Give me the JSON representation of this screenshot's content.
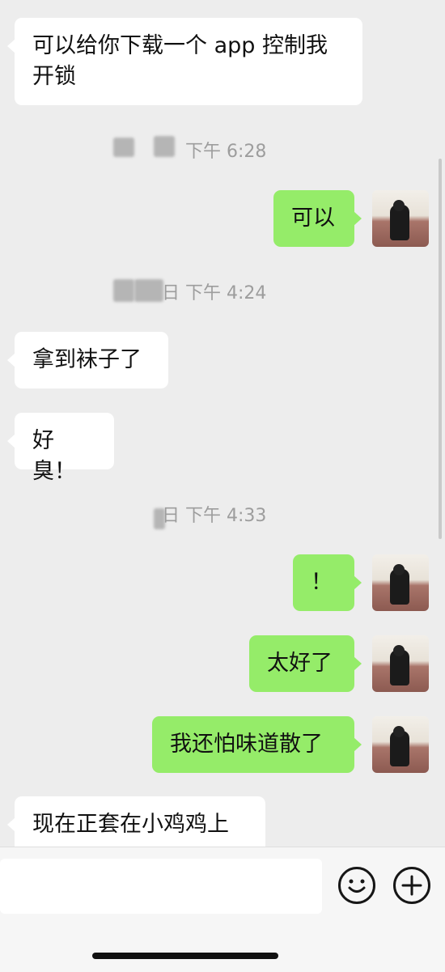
{
  "messages": [
    {
      "side": "left",
      "text": "可以给你下载一个 app 控制我开锁"
    },
    {
      "side": "right",
      "text": "可以"
    },
    {
      "side": "left",
      "text": "拿到袜子了"
    },
    {
      "side": "left",
      "text": "好臭！"
    },
    {
      "side": "right",
      "text": "！"
    },
    {
      "side": "right",
      "text": "太好了"
    },
    {
      "side": "right",
      "text": "我还怕味道散了"
    },
    {
      "side": "left",
      "text": "现在正套在小鸡鸡上"
    }
  ],
  "timestamps": [
    {
      "text": "下午 6:28"
    },
    {
      "text": "日 下午 4:24"
    },
    {
      "text": "日 下午 4:33"
    }
  ],
  "colors": {
    "background": "#ededed",
    "incoming": "#ffffff",
    "outgoing": "#95ec69"
  },
  "icons": {
    "emoji": "emoji-icon",
    "plus": "plus-icon"
  }
}
